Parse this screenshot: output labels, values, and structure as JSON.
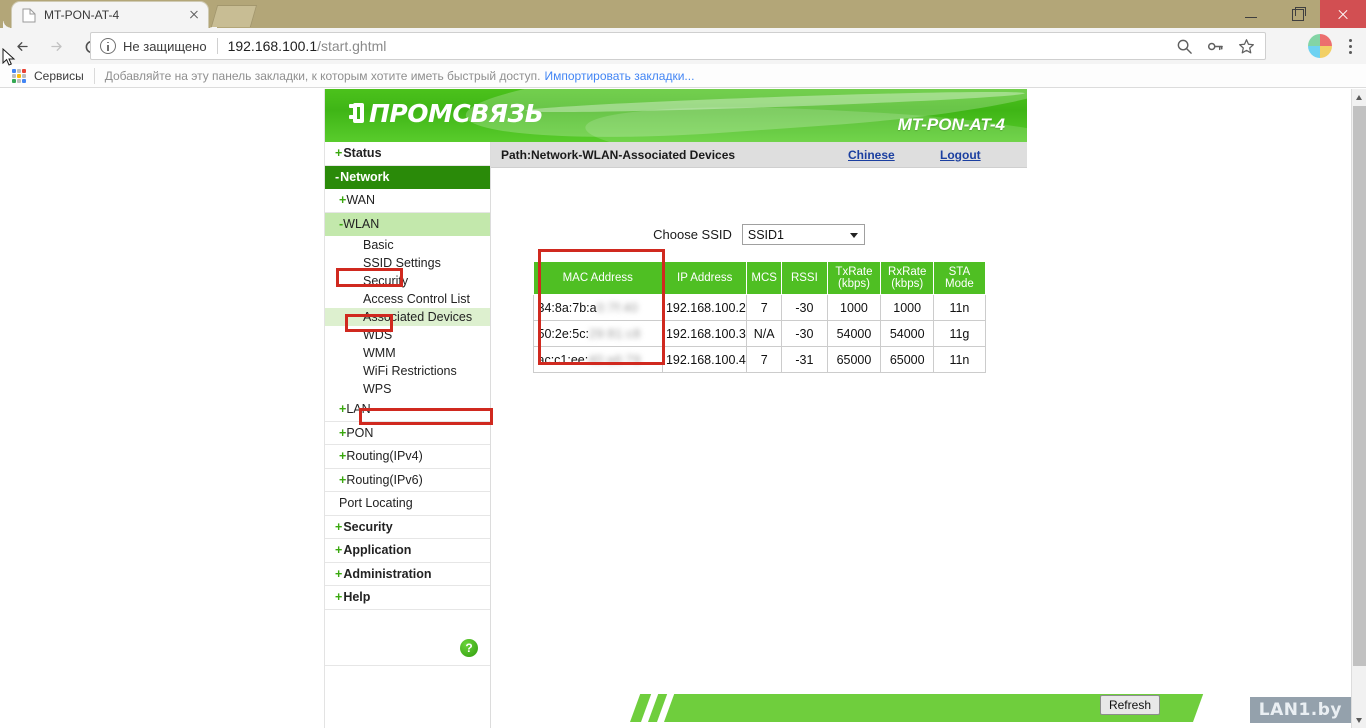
{
  "browser": {
    "tab": {
      "title": "MT-PON-AT-4",
      "favicon_icon": "page-icon",
      "close_icon": "close-icon"
    },
    "new_tab_icon": "new-tab-icon",
    "window_controls": {
      "minimize_icon": "minimize-icon",
      "maximize_icon": "maximize-icon",
      "close_icon": "window-close-icon"
    },
    "nav": {
      "back_icon": "arrow-back-icon",
      "forward_icon": "arrow-forward-icon",
      "reload_icon": "reload-icon"
    },
    "omnibox": {
      "info_icon": "info-circle-icon",
      "security_label": "Не защищено",
      "url_host": "192.168.100.1",
      "url_path": "/start.ghtml",
      "search_icon": "search-icon",
      "password_icon": "key-icon",
      "bookmark_icon": "star-icon"
    },
    "profile_icon": "profile-avatar-icon",
    "menu_icon": "kebab-menu-icon",
    "bookmarks_bar": {
      "apps_icon": "apps-grid-icon",
      "services_label": "Сервисы",
      "hint": "Добавляйте на эту панель закладки, к которым хотите иметь быстрый доступ.",
      "import_link": "Импортировать закладки..."
    }
  },
  "router": {
    "banner": {
      "logo_text": "ПРОМСВЯЗЬ",
      "logo_icon": "plug-logo-icon",
      "model": "MT-PON-AT-4"
    },
    "sidebar": {
      "items": [
        {
          "label": "Status",
          "prefix": "+",
          "level": "top",
          "state": "normal"
        },
        {
          "label": "Network",
          "prefix": "-",
          "level": "top",
          "state": "selected-dark"
        },
        {
          "label": "WAN",
          "prefix": "+",
          "level": "sub",
          "state": "normal"
        },
        {
          "label": "WLAN",
          "prefix": "-",
          "level": "sub",
          "state": "selected-light"
        },
        {
          "label": "Basic",
          "prefix": "",
          "level": "leaf",
          "state": "normal"
        },
        {
          "label": "SSID Settings",
          "prefix": "",
          "level": "leaf",
          "state": "normal"
        },
        {
          "label": "Security",
          "prefix": "",
          "level": "leaf",
          "state": "normal"
        },
        {
          "label": "Access Control List",
          "prefix": "",
          "level": "leaf",
          "state": "normal"
        },
        {
          "label": "Associated Devices",
          "prefix": "",
          "level": "leaf",
          "state": "selected-light"
        },
        {
          "label": "WDS",
          "prefix": "",
          "level": "leaf",
          "state": "normal"
        },
        {
          "label": "WMM",
          "prefix": "",
          "level": "leaf",
          "state": "normal"
        },
        {
          "label": "WiFi Restrictions",
          "prefix": "",
          "level": "leaf",
          "state": "normal"
        },
        {
          "label": "WPS",
          "prefix": "",
          "level": "leaf",
          "state": "normal"
        },
        {
          "label": "LAN",
          "prefix": "+",
          "level": "sub",
          "state": "normal"
        },
        {
          "label": "PON",
          "prefix": "+",
          "level": "sub",
          "state": "normal"
        },
        {
          "label": "Routing(IPv4)",
          "prefix": "+",
          "level": "sub",
          "state": "normal"
        },
        {
          "label": "Routing(IPv6)",
          "prefix": "+",
          "level": "sub",
          "state": "normal"
        },
        {
          "label": "Port Locating",
          "prefix": "",
          "level": "plain",
          "state": "normal"
        },
        {
          "label": "Security",
          "prefix": "+",
          "level": "top",
          "state": "normal"
        },
        {
          "label": "Application",
          "prefix": "+",
          "level": "top",
          "state": "normal"
        },
        {
          "label": "Administration",
          "prefix": "+",
          "level": "top",
          "state": "normal"
        },
        {
          "label": "Help",
          "prefix": "+",
          "level": "top",
          "state": "normal"
        }
      ],
      "help_button_label": "?"
    },
    "path_bar": {
      "path": "Path:Network-WLAN-Associated Devices",
      "chinese_link": "Chinese",
      "logout_link": "Logout"
    },
    "ssid_chooser": {
      "label": "Choose SSID",
      "value": "SSID1",
      "caret_icon": "chevron-down-icon"
    },
    "table": {
      "headers": [
        "MAC Address",
        "IP Address",
        "MCS",
        "RSSI",
        "TxRate (kbps)",
        "RxRate (kbps)",
        "STA Mode"
      ],
      "header_lines": [
        [
          "MAC Address"
        ],
        [
          "IP Address"
        ],
        [
          "MCS"
        ],
        [
          "RSSI"
        ],
        [
          "TxRate",
          "(kbps)"
        ],
        [
          "RxRate",
          "(kbps)"
        ],
        [
          "STA",
          "Mode"
        ]
      ],
      "rows": [
        {
          "mac_visible": "34:8a:7b:a",
          "mac_redacted": "0:7f:40",
          "ip": "192.168.100.2",
          "mcs": "7",
          "rssi": "-30",
          "tx": "1000",
          "rx": "1000",
          "sta": "11n"
        },
        {
          "mac_visible": "50:2e:5c:",
          "mac_redacted": "29:81:c8",
          "ip": "192.168.100.3",
          "mcs": "N/A",
          "rssi": "-30",
          "tx": "54000",
          "rx": "54000",
          "sta": "11g"
        },
        {
          "mac_visible": "ac:c1:ee:",
          "mac_redacted": "40:a6:79",
          "ip": "192.168.100.4",
          "mcs": "7",
          "rssi": "-31",
          "tx": "65000",
          "rx": "65000",
          "sta": "11n"
        }
      ]
    },
    "footer": {
      "refresh_label": "Refresh"
    }
  },
  "watermark": {
    "text": "LAN1.by"
  },
  "colors": {
    "banner_green": "#3fb516",
    "table_header_green": "#4fbf23",
    "menu_selected_dark": "#2a8a09",
    "menu_selected_light": "#c3e8ac",
    "annotation_red": "#d0291f",
    "footer_green": "#6fce3d",
    "titlebar_khaki": "#b3a678",
    "close_button_red": "#d24f52",
    "link_blue": "#1b3fa0"
  }
}
